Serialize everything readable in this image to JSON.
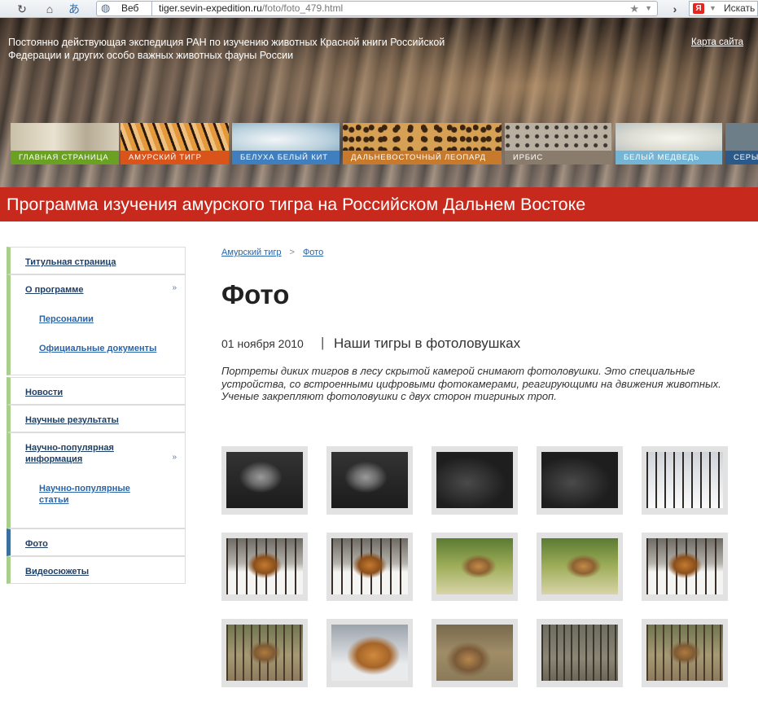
{
  "browser": {
    "search_provider_label": "Веб",
    "url_domain": "tiger.sevin-expedition.ru",
    "url_path": "/foto/foto_479.html",
    "yandex_letter": "Я",
    "yandex_search_label": "Искать"
  },
  "header": {
    "org_title": "Постоянно действующая экспедиция РАН по изучению животных Красной книги Российской Федерации и других особо важных животных фауны России",
    "sitemap_link": "Карта сайта",
    "tabs": [
      {
        "label": "Главная страница",
        "color": "#6aa123"
      },
      {
        "label": "Амурский тигр",
        "color": "#d8541a"
      },
      {
        "label": "Белуха белый кит",
        "color": "#3f7fc0"
      },
      {
        "label": "Дальневосточный леопард",
        "color": "#c77a2c"
      },
      {
        "label": "Ирбис",
        "color": "#8a7c6d"
      },
      {
        "label": "Белый медведь",
        "color": "#74b4d4"
      },
      {
        "label": "Серый",
        "color": "#2b5a8a"
      }
    ]
  },
  "program_title": "Программа изучения амурского тигра на Российском Дальнем Востоке",
  "sidebar": {
    "items": [
      {
        "label": "Титульная страница"
      },
      {
        "label": "О программе",
        "sub": [
          "Персоналии",
          "Официальные документы"
        ]
      },
      {
        "label": "Новости"
      },
      {
        "label": "Научные результаты"
      },
      {
        "label": "Научно-популярная информация",
        "sub": [
          "Научно-популярные статьи"
        ]
      },
      {
        "label": "Фото"
      },
      {
        "label": "Видеосюжеты"
      }
    ]
  },
  "breadcrumb": {
    "items": [
      "Амурский тигр",
      "Фото"
    ],
    "separator": ">"
  },
  "page": {
    "title": "Фото",
    "date": "01 ноября 2010",
    "date_separator": "|",
    "post_title": "Наши тигры в фотоловушках",
    "description": "Портреты диких тигров в лесу скрытой камерой снимают фотоловушки. Это специальные устройства, со встроенными цифровыми фотокамерами, реагирующими на движения животных. Ученые закрепляют фотоловушки с двух сторон тигриных троп."
  },
  "colors": {
    "accent_red": "#c7291d",
    "link_blue": "#2a64a8",
    "sidebar_green": "#a8cf8b",
    "sidebar_active": "#3d6f9c"
  },
  "thumbnails": [
    {
      "scene": "night-tiger"
    },
    {
      "scene": "night-tiger"
    },
    {
      "scene": "night-dark"
    },
    {
      "scene": "night-dark"
    },
    {
      "scene": "snow-forest"
    },
    {
      "scene": "tiger-snow"
    },
    {
      "scene": "tiger-snow"
    },
    {
      "scene": "tiger-green"
    },
    {
      "scene": "tiger-green"
    },
    {
      "scene": "tiger-snow"
    },
    {
      "scene": "tiger-forest"
    },
    {
      "scene": "tiger-snow-close"
    },
    {
      "scene": "tiger-lying"
    },
    {
      "scene": "forest-dim"
    },
    {
      "scene": "tiger-forest"
    }
  ]
}
